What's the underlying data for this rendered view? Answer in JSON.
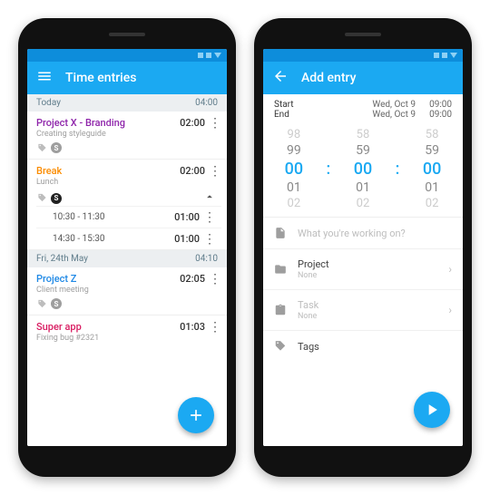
{
  "left": {
    "appbar_title": "Time entries",
    "sections": [
      {
        "label": "Today",
        "total": "04:00"
      },
      {
        "label": "Fri, 24th May",
        "total": "04:10"
      }
    ],
    "entries": {
      "e0": {
        "title": "Project X - Branding",
        "sub": "Creating styleguide",
        "dur": "02:00"
      },
      "e1": {
        "title": "Break",
        "sub": "Lunch",
        "dur": "02:00",
        "sub1": {
          "range": "10:30 - 11:30",
          "dur": "01:00"
        },
        "sub2": {
          "range": "14:30 - 15:30",
          "dur": "01:00"
        }
      },
      "e2": {
        "title": "Project Z",
        "sub": "Client meeting",
        "dur": "02:05"
      },
      "e3": {
        "title": "Super app",
        "sub": "Fixing bug #2321",
        "dur": "01:03"
      }
    }
  },
  "right": {
    "appbar_title": "Add entry",
    "start": {
      "label": "Start",
      "date": "Wed, Oct 9",
      "time": "09:00"
    },
    "end": {
      "label": "End",
      "date": "Wed, Oct 9",
      "time": "09:00"
    },
    "picker": {
      "h": [
        "98",
        "99",
        "00",
        "01",
        "02"
      ],
      "m": [
        "58",
        "59",
        "00",
        "01",
        "02"
      ],
      "s": [
        "58",
        "59",
        "00",
        "01",
        "02"
      ]
    },
    "desc_placeholder": "What you're working on?",
    "project": {
      "label": "Project",
      "value": "None"
    },
    "task": {
      "label": "Task",
      "value": "None"
    },
    "tags": {
      "label": "Tags"
    }
  }
}
